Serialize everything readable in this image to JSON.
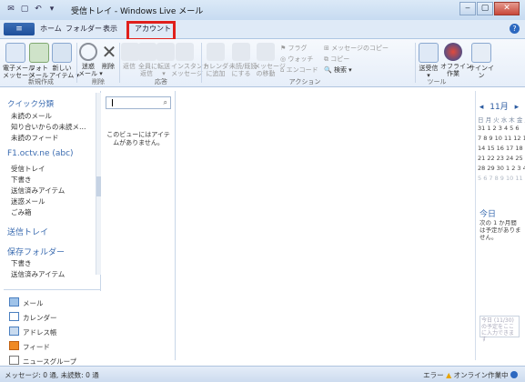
{
  "window": {
    "title": "受信トレイ - Windows Live メール"
  },
  "tabs": {
    "file": "≡",
    "home": "ホーム",
    "folder": "フォルダー",
    "view": "表示",
    "account": "アカウント"
  },
  "ribbon": {
    "new_email": "電子メール\nメッセージ",
    "photo_email": "フォト\nメール",
    "new_item": "新しい\nアイテム ▾",
    "junk": "迷惑\nメール ▾",
    "delete": "削除",
    "reply": "返信",
    "reply_all": "全員に\n返信",
    "forward": "転送\n▾",
    "instant": "インスタント\nメッセージ",
    "add_calendar": "カレンダー\nに追加",
    "unread": "未読/既読\nにする",
    "move": "メッセージ\nの移動",
    "flag": "フラグ",
    "watch": "ウォッチ",
    "encoding": "エンコード",
    "copy_to": "メッセージのコピー",
    "copy": "コピー",
    "find": "検索 ▾",
    "send_receive": "送受信\n▾",
    "offline": "オフライン\n作業",
    "sign_in": "サインイン",
    "group_new": "新規作成",
    "group_delete": "削除",
    "group_respond": "応答",
    "group_actions": "アクション",
    "group_tools": "ツール"
  },
  "nav": {
    "quick_views": "クイック分類",
    "unread_email": "未読のメール",
    "unread_contacts": "知り合いからの未読メ…",
    "unread_feeds": "未読のフィード",
    "account_name": "F1.octv.ne (abc)",
    "inbox": "受信トレイ",
    "drafts": "下書き",
    "sent": "送信済みアイテム",
    "junk": "迷惑メール",
    "deleted": "ごみ箱",
    "outbox": "送信トレイ",
    "storage": "保存フォルダー",
    "storage_drafts": "下書き",
    "storage_sent": "送信済みアイテム"
  },
  "modules": {
    "mail": "メール",
    "calendar": "カレンダー",
    "contacts": "アドレス帳",
    "feeds": "フィード",
    "newsgroups": "ニュースグループ"
  },
  "message_list": {
    "empty": "このビューにはアイテムがありません。"
  },
  "calendar": {
    "month": "11月",
    "prev": "◂",
    "next": "▸",
    "weekdays": "日 月 火 水 木 金 土",
    "rows": [
      "31 1 2 3 4 5 6",
      "7 8 9 10 11 12 13",
      "14 15 16 17 18 19 20",
      "21 22 23 24 25 26 27",
      "28 29 30 1 2 3 4",
      "5 6 7 8 9 10 11"
    ],
    "today": "今日",
    "no_events": "次の 1 か月間は予定がありません。",
    "note": "今日 (11/30) の予定をここに入力できます"
  },
  "status": {
    "left": "メッセージ: 0 通, 未読数: 0 通",
    "error": "エラー",
    "online": "オンライン作業中"
  },
  "colors": {
    "accent": "#2c68c0",
    "highlight": "#e0201c"
  }
}
